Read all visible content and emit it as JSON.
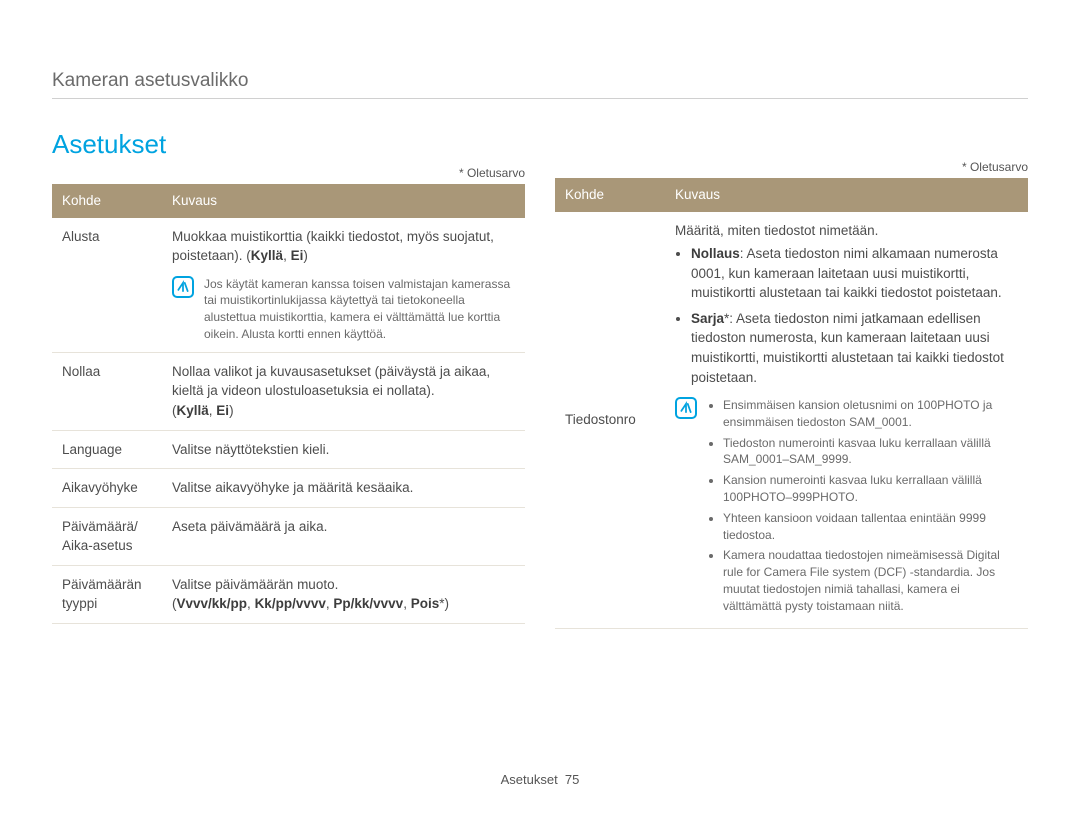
{
  "breadcrumb": "Kameran asetusvalikko",
  "section_title": "Asetukset",
  "default_note": "* Oletusarvo",
  "headers": {
    "kohde": "Kohde",
    "kuvaus": "Kuvaus"
  },
  "left_rows": {
    "alusta": {
      "label": "Alusta",
      "desc_line1": "Muokkaa muistikorttia (kaikki tiedostot, myös suojatut, poistetaan). (",
      "opt1": "Kyllä",
      "sep": ", ",
      "opt2": "Ei",
      "close": ")",
      "note": "Jos käytät kameran kanssa toisen valmistajan kamerassa tai muistikortinlukijassa käytettyä tai tietokoneella alustettua muistikorttia, kamera ei välttämättä lue korttia oikein. Alusta kortti ennen käyttöä."
    },
    "nollaa": {
      "label": "Nollaa",
      "desc": "Nollaa valikot ja kuvausasetukset (päiväystä ja aikaa, kieltä ja videon ulostuloasetuksia ei nollata).",
      "open": "(",
      "opt1": "Kyllä",
      "sep": ", ",
      "opt2": "Ei",
      "close": ")"
    },
    "language": {
      "label": "Language",
      "desc": "Valitse näyttötekstien kieli."
    },
    "aikavyohyke": {
      "label": "Aikavyöhyke",
      "desc": "Valitse aikavyöhyke ja määritä kesäaika."
    },
    "pvm_aika": {
      "label": "Päivämäärä/\nAika-asetus",
      "desc": "Aseta päivämäärä ja aika."
    },
    "pvm_tyyppi": {
      "label": "Päivämäärän tyyppi",
      "desc": "Valitse päivämäärän muoto.",
      "open": "(",
      "opt1": "Vvvv/kk/pp",
      "sep": ", ",
      "opt2": "Kk/pp/vvvv",
      "opt3": "Pp/kk/vvvv",
      "opt4": "Pois",
      "star": "*",
      "close": ")"
    }
  },
  "right_row": {
    "label": "Tiedostonro",
    "intro": "Määritä, miten tiedostot nimetään.",
    "b1_name": "Nollaus",
    "b1_rest": ": Aseta tiedoston nimi alkamaan numerosta 0001, kun kameraan laitetaan uusi muistikortti, muistikortti alustetaan tai kaikki tiedostot poistetaan.",
    "b2_name": "Sarja",
    "b2_star": "*",
    "b2_rest": ": Aseta tiedoston nimi jatkamaan edellisen tiedoston numerosta, kun kameraan laitetaan uusi muistikortti, muistikortti alustetaan tai kaikki tiedostot poistetaan.",
    "notes": {
      "n1": "Ensimmäisen kansion oletusnimi on 100PHOTO ja ensimmäisen tiedoston SAM_0001.",
      "n2": "Tiedoston numerointi kasvaa luku kerrallaan välillä SAM_0001–SAM_9999.",
      "n3": "Kansion numerointi kasvaa luku kerrallaan välillä 100PHOTO–999PHOTO.",
      "n4": "Yhteen kansioon voidaan tallentaa enintään 9999 tiedostoa.",
      "n5": "Kamera noudattaa tiedostojen nimeämisessä Digital rule for Camera File system (DCF) -standardia. Jos muutat tiedostojen nimiä tahallasi, kamera ei välttämättä pysty toistamaan niitä."
    }
  },
  "footer": {
    "label": "Asetukset",
    "page": "75"
  },
  "icon_name": "note-icon"
}
